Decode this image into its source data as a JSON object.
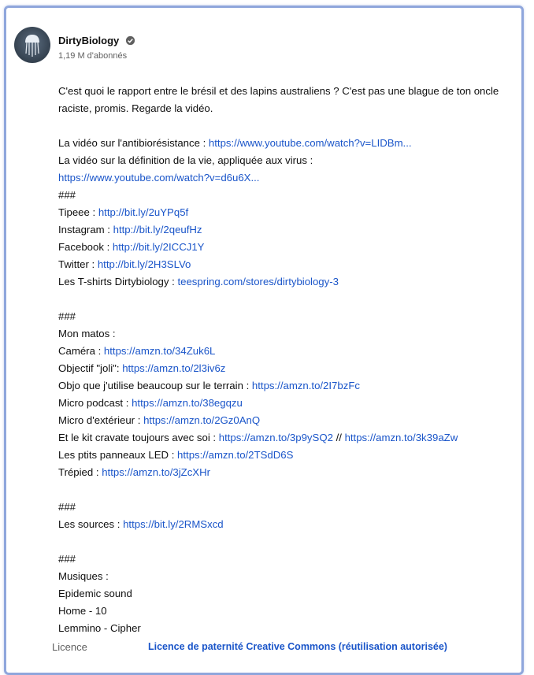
{
  "channel": {
    "name": "DirtyBiology",
    "subscribers": "1,19 M d'abonnés"
  },
  "description": {
    "intro_1": "C'est quoi le rapport entre le brésil et des lapins australiens ? C'est pas une blague de ton oncle",
    "intro_2": "raciste, promis. Regarde la vidéo.",
    "antibio_label": "La vidéo sur l'antibiorésistance : ",
    "antibio_url": "https://www.youtube.com/watch?v=LIDBm...",
    "virus_label": "La vidéo sur la définition de la vie, appliquée aux virus :",
    "virus_url": "https://www.youtube.com/watch?v=d6u6X...",
    "sep1": "###",
    "tipeee_label": "Tipeee : ",
    "tipeee_url": "http://bit.ly/2uYPq5f",
    "instagram_label": "Instagram : ",
    "instagram_url": "http://bit.ly/2qeufHz",
    "facebook_label": "Facebook : ",
    "facebook_url": "http://bit.ly/2ICCJ1Y",
    "twitter_label": "Twitter : ",
    "twitter_url": "http://bit.ly/2H3SLVo",
    "tshirts_label": "Les T-shirts Dirtybiology : ",
    "tshirts_url": "teespring.com/stores/dirtybiology-3",
    "sep2": "###",
    "matos_title": "Mon matos :",
    "camera_label": "Caméra : ",
    "camera_url": "https://amzn.to/34Zuk6L",
    "objectif_label": "Objectif \"joli\": ",
    "objectif_url": "https://amzn.to/2l3iv6z",
    "objo_label": "Objo que j'utilise beaucoup sur le terrain : ",
    "objo_url": "https://amzn.to/2I7bzFc",
    "micro_podcast_label": "Micro podcast : ",
    "micro_podcast_url": "https://amzn.to/38egqzu",
    "micro_ext_label": "Micro d'extérieur : ",
    "micro_ext_url": "https://amzn.to/2Gz0AnQ",
    "kit_label": "Et le kit cravate toujours avec soi : ",
    "kit_url_1": "https://amzn.to/3p9ySQ2",
    "kit_sep": " // ",
    "kit_url_2": "https://amzn.to/3k39aZw",
    "led_label": "Les ptits panneaux LED : ",
    "led_url": "https://amzn.to/2TSdD6S",
    "trepied_label": "Trépied : ",
    "trepied_url": "https://amzn.to/3jZcXHr",
    "sep3": "###",
    "sources_label": "Les sources : ",
    "sources_url": "https://bit.ly/2RMSxcd",
    "sep4": "###",
    "musiques_title": "Musiques :",
    "music_1": "Epidemic sound",
    "music_2": "Home - 10",
    "music_3": "Lemmino - Cipher"
  },
  "footer": {
    "licence_label": "Licence",
    "licence_value": "Licence de paternité Creative Commons (réutilisation autorisée)"
  },
  "colors": {
    "link": "#1a55c9",
    "frame_border": "#8fa6dc"
  }
}
